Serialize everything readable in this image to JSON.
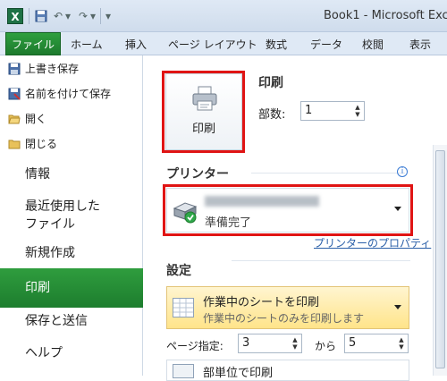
{
  "window": {
    "title": "Book1 - Microsoft Exce",
    "app_icon": "X"
  },
  "qat": {
    "save_icon": "save-icon",
    "undo_icon": "↶",
    "undo_drop": "▾",
    "redo_icon": "↷",
    "redo_drop": "▾",
    "customize": "▾"
  },
  "ribbon": {
    "tabs": [
      "ファイル",
      "ホーム",
      "挿入",
      "ページ レイアウト",
      "数式",
      "データ",
      "校閲",
      "表示"
    ]
  },
  "leftnav": {
    "small_items": [
      "上書き保存",
      "名前を付けて保存",
      "開く",
      "閉じる"
    ],
    "items": [
      "情報",
      "最近使用した",
      "ファイル",
      "新規作成",
      "印刷",
      "保存と送信",
      "ヘルプ"
    ]
  },
  "print": {
    "button_label": "印刷",
    "section_title": "印刷",
    "copies_label": "部数:",
    "copies_value": "1"
  },
  "printer": {
    "section_title": "プリンター",
    "status": "準備完了",
    "properties_link": "プリンターのプロパティ",
    "info_glyph": "i"
  },
  "settings": {
    "section_title": "設定",
    "sheet_main": "作業中のシートを印刷",
    "sheet_sub": "作業中のシートのみを印刷します",
    "pages_label": "ページ指定:",
    "pages_from": "3",
    "pages_to_label": "から",
    "pages_to": "5",
    "collate_label": "部単位で印刷"
  },
  "colors": {
    "file_tab": "#1d7a2d",
    "highlight": "#e01414",
    "link": "#2a5fa8"
  }
}
